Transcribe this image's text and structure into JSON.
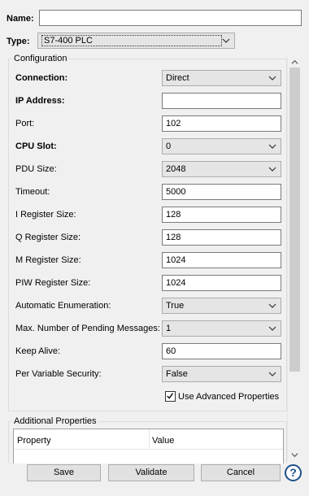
{
  "header": {
    "name_label": "Name:",
    "name_value": "",
    "type_label": "Type:",
    "type_value": "S7-400 PLC"
  },
  "configuration": {
    "title": "Configuration",
    "rows": [
      {
        "label": "Connection:",
        "bold": true,
        "kind": "combo",
        "value": "Direct"
      },
      {
        "label": "IP Address:",
        "bold": true,
        "kind": "text",
        "value": ""
      },
      {
        "label": "Port:",
        "bold": false,
        "kind": "text",
        "value": "102"
      },
      {
        "label": "CPU Slot:",
        "bold": true,
        "kind": "combo",
        "value": "0"
      },
      {
        "label": "PDU Size:",
        "bold": false,
        "kind": "combo",
        "value": "2048"
      },
      {
        "label": "Timeout:",
        "bold": false,
        "kind": "text",
        "value": "5000"
      },
      {
        "label": "I Register Size:",
        "bold": false,
        "kind": "text",
        "value": "128"
      },
      {
        "label": "Q Register Size:",
        "bold": false,
        "kind": "text",
        "value": "128"
      },
      {
        "label": "M Register Size:",
        "bold": false,
        "kind": "text",
        "value": "1024"
      },
      {
        "label": "PIW Register Size:",
        "bold": false,
        "kind": "text",
        "value": "1024"
      },
      {
        "label": "Automatic Enumeration:",
        "bold": false,
        "kind": "combo",
        "value": "True"
      },
      {
        "label": "Max. Number of Pending Messages:",
        "bold": false,
        "kind": "combo",
        "value": "1"
      },
      {
        "label": "Keep Alive:",
        "bold": false,
        "kind": "text",
        "value": "60"
      },
      {
        "label": "Per Variable Security:",
        "bold": false,
        "kind": "combo",
        "value": "False"
      }
    ],
    "advanced_checkbox_label": "Use Advanced Properties",
    "advanced_checked": true
  },
  "additional": {
    "title": "Additional Properties",
    "columns": [
      "Property",
      "Value"
    ]
  },
  "buttons": {
    "save": "Save",
    "validate": "Validate",
    "cancel": "Cancel",
    "help": "?"
  },
  "colors": {
    "background": "#f0f0f0",
    "help_blue": "#1c4f8c"
  },
  "icons": [
    "chevron-down-icon",
    "checkmark-icon",
    "help-icon",
    "scroll-up-icon",
    "scroll-down-icon"
  ]
}
